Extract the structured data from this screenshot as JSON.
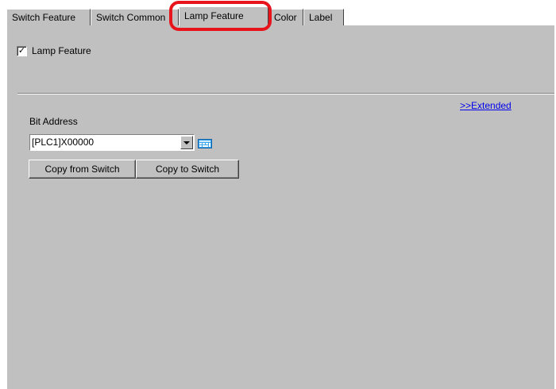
{
  "tabs": [
    {
      "label": "Switch Feature"
    },
    {
      "label": "Switch Common"
    },
    {
      "label": "Lamp Feature"
    },
    {
      "label": "Color"
    },
    {
      "label": "Label"
    }
  ],
  "active_tab": "Lamp Feature",
  "lamp": {
    "checkbox_label": "Lamp Feature",
    "checked": true,
    "check_glyph": "✓"
  },
  "extended_link": ">>Extended",
  "bit_address": {
    "label": "Bit Address",
    "value": "[PLC1]X00000"
  },
  "buttons": {
    "copy_from": "Copy from Switch",
    "copy_to": "Copy to Switch"
  },
  "colors": {
    "panel": "#c0c0c0",
    "highlight": "#e8141c",
    "link": "#0000ee"
  }
}
